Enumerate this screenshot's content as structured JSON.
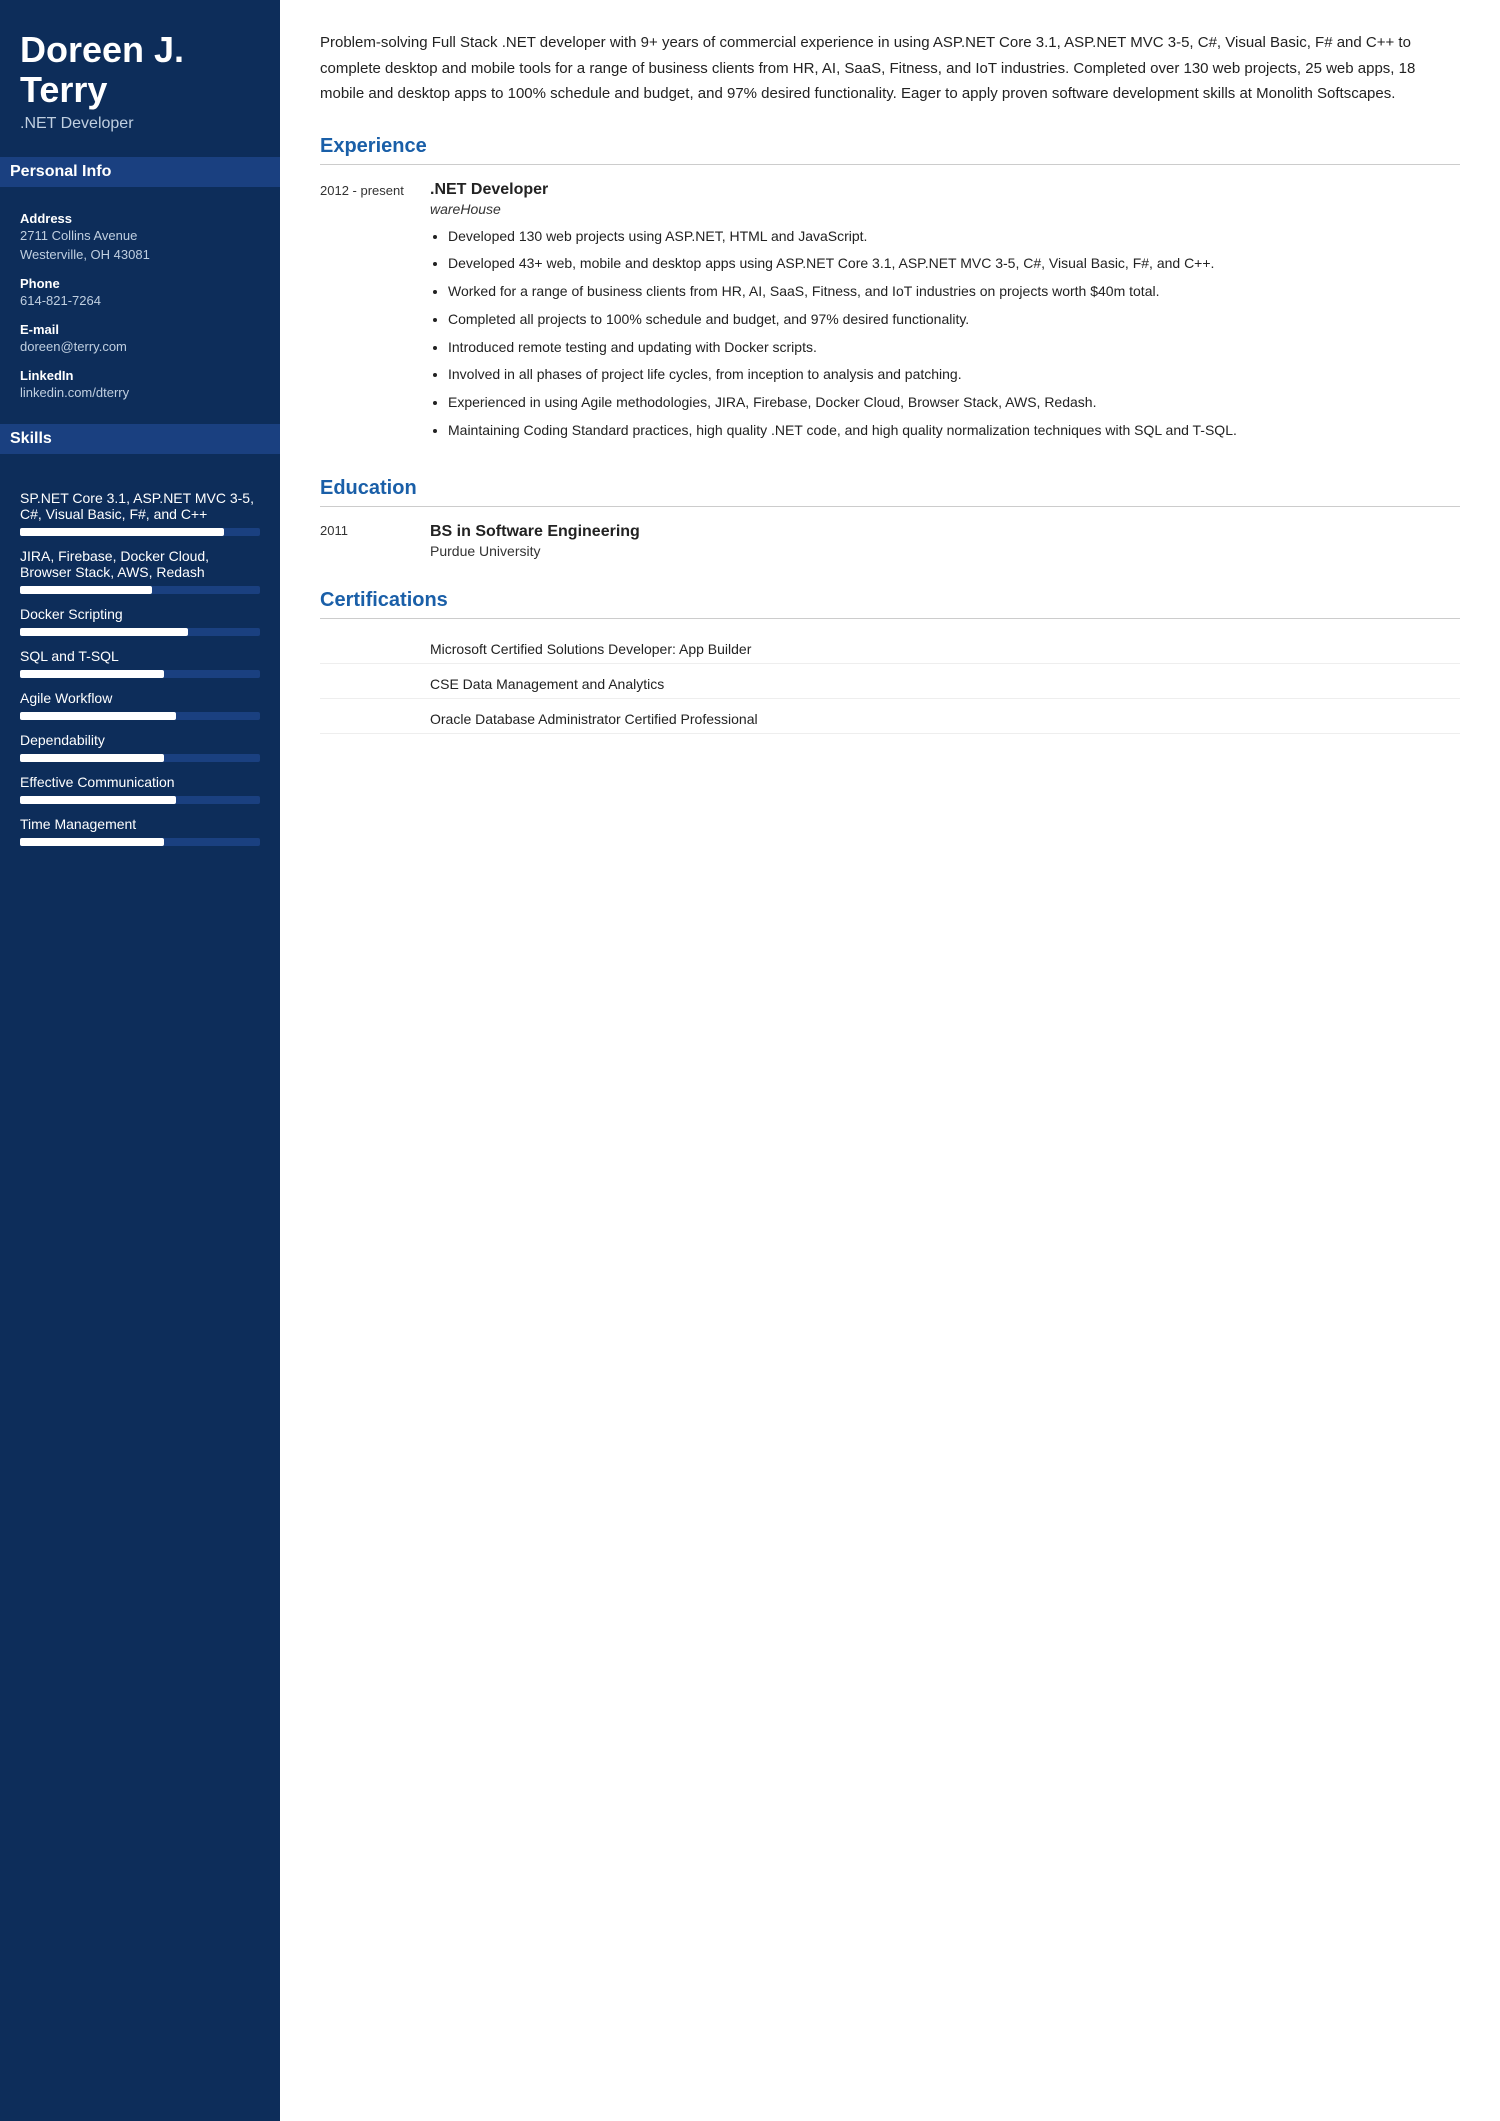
{
  "sidebar": {
    "name": "Doreen J. Terry",
    "title": ".NET Developer",
    "personal_info_header": "Personal Info",
    "address_label": "Address",
    "address_line1": "2711 Collins Avenue",
    "address_line2": "Westerville, OH 43081",
    "phone_label": "Phone",
    "phone_value": "614-821-7264",
    "email_label": "E-mail",
    "email_value": "doreen@terry.com",
    "linkedin_label": "LinkedIn",
    "linkedin_value": "linkedin.com/dterry",
    "skills_header": "Skills",
    "skills": [
      {
        "name": "SP.NET Core 3.1, ASP.NET MVC 3-5, C#, Visual Basic, F#, and C++",
        "fill": 85
      },
      {
        "name": "JIRA, Firebase, Docker Cloud, Browser Stack, AWS, Redash",
        "fill": 55
      },
      {
        "name": "Docker Scripting",
        "fill": 70
      },
      {
        "name": "SQL and T-SQL",
        "fill": 60
      },
      {
        "name": "Agile Workflow",
        "fill": 65
      },
      {
        "name": "Dependability",
        "fill": 60
      },
      {
        "name": "Effective Communication",
        "fill": 65
      },
      {
        "name": "Time Management",
        "fill": 60
      }
    ]
  },
  "main": {
    "summary": "Problem-solving Full Stack .NET developer with 9+ years of commercial experience in using ASP.NET Core 3.1, ASP.NET MVC 3-5, C#, Visual Basic, F# and C++ to complete desktop and mobile tools for a range of business clients from HR, AI, SaaS, Fitness, and IoT industries. Completed over 130 web projects, 25 web apps, 18 mobile and desktop apps to 100% schedule and budget, and 97% desired functionality. Eager to apply proven software development skills at Monolith Softscapes.",
    "experience_header": "Experience",
    "experiences": [
      {
        "date": "2012 - present",
        "title": ".NET Developer",
        "company": "wareHouse",
        "bullets": [
          "Developed 130 web projects using ASP.NET, HTML and JavaScript.",
          "Developed 43+ web, mobile and desktop apps using ASP.NET Core 3.1, ASP.NET MVC 3-5, C#, Visual Basic, F#, and C++.",
          "Worked for a range of business clients from HR, AI, SaaS, Fitness, and IoT industries on projects worth $40m total.",
          "Completed all projects to 100% schedule and budget, and 97% desired functionality.",
          "Introduced remote testing and updating with Docker scripts.",
          "Involved in all phases of project life cycles, from inception to analysis and patching.",
          "Experienced in using Agile methodologies, JIRA, Firebase, Docker Cloud, Browser Stack, AWS, Redash.",
          "Maintaining Coding Standard practices, high quality .NET code, and high quality normalization techniques with SQL and T-SQL."
        ]
      }
    ],
    "education_header": "Education",
    "educations": [
      {
        "year": "2011",
        "degree": "BS in Software Engineering",
        "school": "Purdue University"
      }
    ],
    "certifications_header": "Certifications",
    "certifications": [
      "Microsoft Certified Solutions Developer: App Builder",
      "CSE Data Management and Analytics",
      "Oracle Database Administrator Certified Professional"
    ]
  }
}
